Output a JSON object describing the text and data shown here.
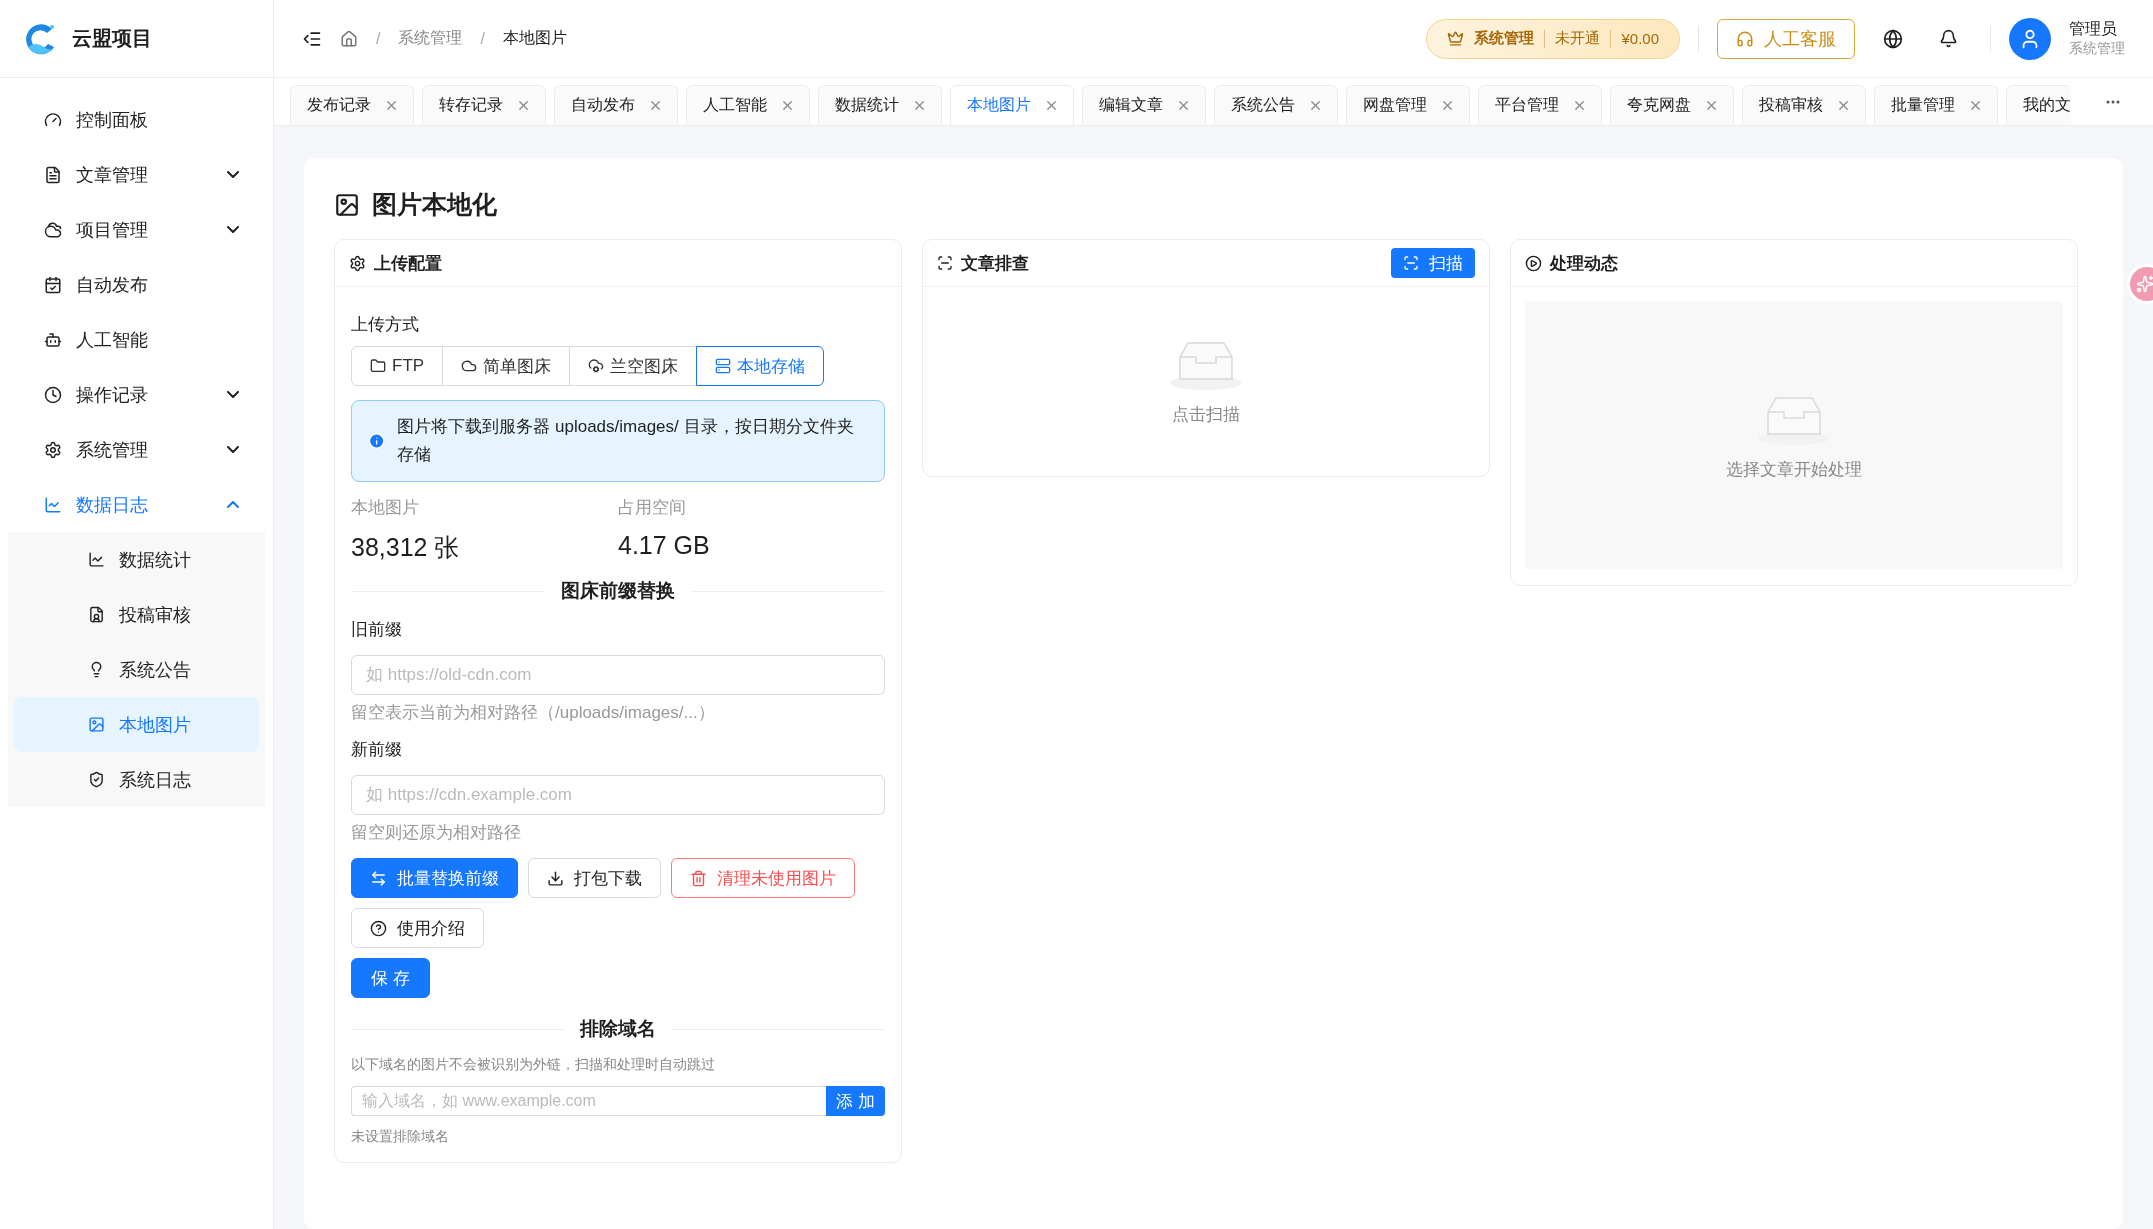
{
  "brand": {
    "name": "云盟项目"
  },
  "sidebar": {
    "items": [
      {
        "label": "控制面板",
        "selected": false
      },
      {
        "label": "文章管理",
        "selected": false,
        "expanded": false
      },
      {
        "label": "项目管理",
        "selected": false,
        "expanded": false
      },
      {
        "label": "自动发布",
        "selected": false
      },
      {
        "label": "人工智能",
        "selected": false
      },
      {
        "label": "操作记录",
        "selected": false,
        "expanded": false
      },
      {
        "label": "系统管理",
        "selected": false,
        "expanded": false
      },
      {
        "label": "数据日志",
        "selected": true,
        "expanded": true,
        "children": [
          {
            "label": "数据统计",
            "selected": false
          },
          {
            "label": "投稿审核",
            "selected": false
          },
          {
            "label": "系统公告",
            "selected": false
          },
          {
            "label": "本地图片",
            "selected": true
          },
          {
            "label": "系统日志",
            "selected": false
          }
        ]
      }
    ]
  },
  "header": {
    "breadcrumb": [
      "系统管理",
      "本地图片"
    ],
    "breadcrumb_separator": "/",
    "plan_badge": {
      "plan": "系统管理",
      "status": "未开通",
      "balance": "¥0.00"
    },
    "support_button": "人工客服",
    "user": {
      "name": "管理员",
      "role": "系统管理"
    }
  },
  "tabs": [
    {
      "label": "发布记录",
      "selected": false
    },
    {
      "label": "转存记录",
      "selected": false
    },
    {
      "label": "自动发布",
      "selected": false
    },
    {
      "label": "人工智能",
      "selected": false
    },
    {
      "label": "数据统计",
      "selected": false
    },
    {
      "label": "本地图片",
      "selected": true
    },
    {
      "label": "编辑文章",
      "selected": false
    },
    {
      "label": "系统公告",
      "selected": false
    },
    {
      "label": "网盘管理",
      "selected": false
    },
    {
      "label": "平台管理",
      "selected": false
    },
    {
      "label": "夸克网盘",
      "selected": false
    },
    {
      "label": "投稿审核",
      "selected": false
    },
    {
      "label": "批量管理",
      "selected": false
    },
    {
      "label": "我的文",
      "selected": false
    }
  ],
  "page": {
    "title": "图片本地化",
    "upload_config": {
      "title": "上传配置",
      "method_label": "上传方式",
      "methods": [
        {
          "label": "FTP",
          "selected": false
        },
        {
          "label": "简单图床",
          "selected": false
        },
        {
          "label": "兰空图床",
          "selected": false
        },
        {
          "label": "本地存储",
          "selected": true
        }
      ],
      "notice": "图片将下载到服务器 uploads/images/ 目录，按日期分文件夹存储",
      "stats": [
        {
          "label": "本地图片",
          "value": "38,312 张"
        },
        {
          "label": "占用空间",
          "value": "4.17 GB"
        }
      ],
      "prefix_section": {
        "title": "图床前缀替换",
        "fields": [
          {
            "label": "旧前缀",
            "placeholder": "如 https://old-cdn.com",
            "hint": "留空表示当前为相对路径（/uploads/images/...）"
          },
          {
            "label": "新前缀",
            "placeholder": "如 https://cdn.example.com",
            "hint": "留空则还原为相对路径"
          }
        ]
      },
      "buttons": [
        {
          "label": "批量替换前缀",
          "kind": "primary"
        },
        {
          "label": "打包下载",
          "kind": "default"
        },
        {
          "label": "清理未使用图片",
          "kind": "danger"
        },
        {
          "label": "使用介绍",
          "kind": "help"
        }
      ],
      "save_button": "保 存",
      "exclude": {
        "title": "排除域名",
        "description": "以下域名的图片不会被识别为外链，扫描和处理时自动跳过",
        "placeholder": "输入域名，如 www.example.com",
        "add_button": "添 加",
        "empty": "未设置排除域名"
      }
    },
    "scan_panel": {
      "title": "文章排查",
      "button": "扫描",
      "empty": "点击扫描"
    },
    "process_panel": {
      "title": "处理动态",
      "empty": "选择文章开始处理"
    }
  }
}
